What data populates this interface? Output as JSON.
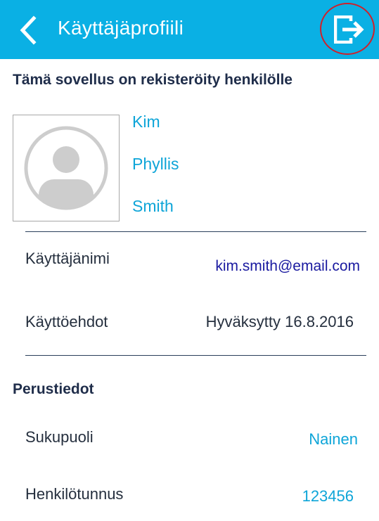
{
  "header": {
    "title": "Käyttäjäprofiili",
    "back_icon": "chevron-left-icon",
    "logout_icon": "logout-icon",
    "bar_color": "#0ab0e4",
    "highlight_color": "#d0202a"
  },
  "profile": {
    "registered_text": "Tämä sovellus on rekisteröity henkilölle",
    "avatar_icon": "user-placeholder-icon",
    "first_name": "Kim",
    "middle_name": "Phyllis",
    "last_name": "Smith"
  },
  "account": {
    "username_label": "Käyttäjänimi",
    "username_value": "kim.smith@email.com",
    "terms_label": "Käyttöehdot",
    "terms_value": "Hyväksytty 16.8.2016"
  },
  "basic_info": {
    "title": "Perustiedot",
    "gender_label": "Sukupuoli",
    "gender_value": "Nainen",
    "id_label": "Henkilötunnus",
    "id_value": "123456"
  },
  "colors": {
    "accent": "#0ea5d8",
    "heading": "#1f2d4a",
    "email": "#1a1aa0"
  }
}
